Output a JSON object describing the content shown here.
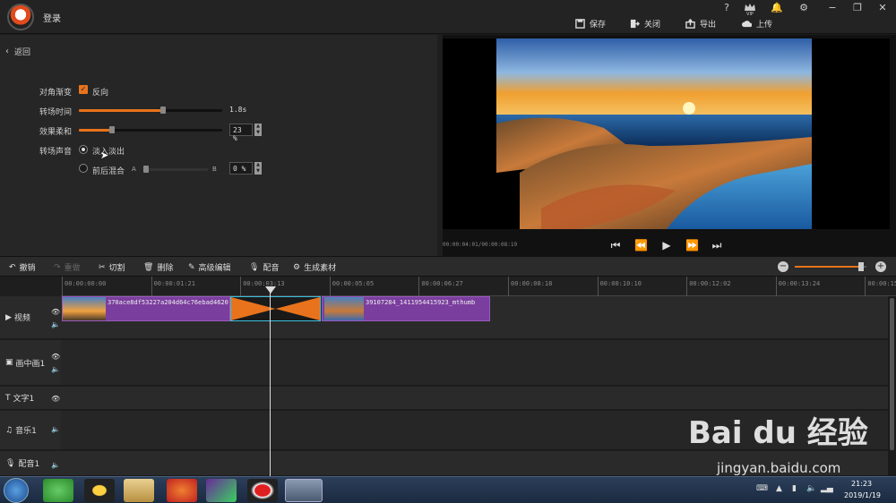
{
  "app": {
    "login": "登录"
  },
  "window_buttons": {
    "help": "?",
    "vip": "VIP",
    "bell": "🔔",
    "settings": "⚙",
    "minimize": "−",
    "maximize": "❐",
    "close": "✕"
  },
  "top_actions": {
    "save": "保存",
    "close": "关闭",
    "export": "导出",
    "upload": "上传"
  },
  "left": {
    "back": "返回",
    "diag_label": "对角渐变",
    "reverse_label": "反向",
    "reverse_checked": true,
    "duration_label": "转场时间",
    "duration_value": "1.8s",
    "duration_fraction": 0.59,
    "softness_label": "效果柔和",
    "softness_value": "23 %",
    "softness_fraction": 0.23,
    "sound_label": "转场声音",
    "fade_label": "淡入淡出",
    "mix_label": "前后混合",
    "mix_a": "A",
    "mix_b": "B",
    "mix_value": "0 %"
  },
  "preview": {
    "time": "00:00:04:01/00:00:08:19"
  },
  "toolbar": {
    "undo": "撤销",
    "redo": "重做",
    "cut": "切割",
    "delete": "删除",
    "advanced": "高级编辑",
    "dub": "配音",
    "generate": "生成素材"
  },
  "zoom": {
    "level": 0.93
  },
  "ruler": {
    "ticks": [
      "00:00:00:00",
      "00:00:01:21",
      "00:00:03:13",
      "00:00:05:05",
      "00:00:06:27",
      "00:00:08:18",
      "00:00:10:10",
      "00:00:12:02",
      "00:00:13:24",
      "00:00:15"
    ]
  },
  "tracks": {
    "video": "视频",
    "pip": "画中画1",
    "text": "文字1",
    "music": "音乐1",
    "voice": "配音1"
  },
  "clips": {
    "clip1": "370ace8df53227a204d64c76ebad4620",
    "clip2": "39107284_1411954415923_mthumb"
  },
  "taskbar": {
    "time": "21:23",
    "date": "2019/1/19"
  },
  "watermark": {
    "brand": "Bai du 经验",
    "url": "jingyan.baidu.com"
  }
}
